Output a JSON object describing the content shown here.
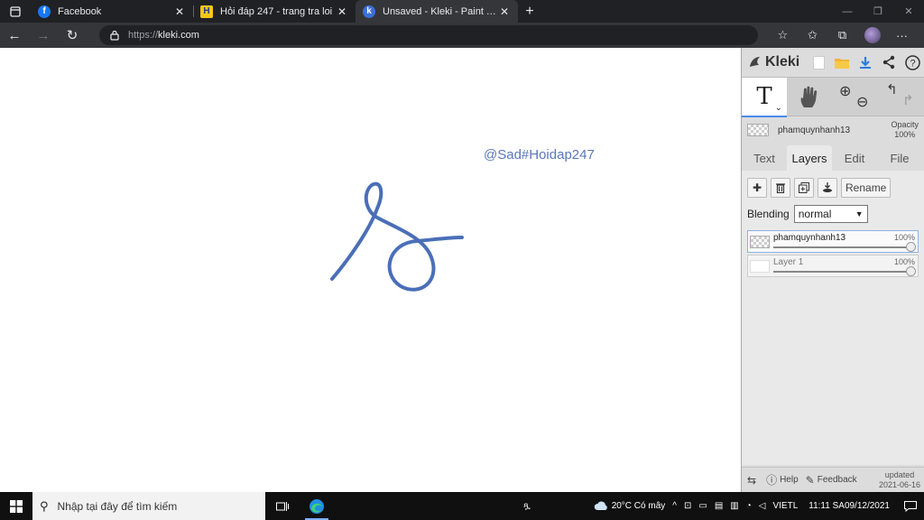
{
  "browser": {
    "tabs": [
      {
        "title": "Facebook",
        "favicon": "facebook-icon",
        "active": false
      },
      {
        "title": "Hỏi đáp 247 - trang tra loi",
        "favicon": "hoidap-icon",
        "active": false
      },
      {
        "title": "Unsaved - Kleki - Paint Tool",
        "favicon": "kleki-icon",
        "active": true
      }
    ],
    "url_prefix": "https://",
    "url_host": "kleki.com"
  },
  "canvas": {
    "watermark": "@Sad#Hoidap247",
    "stroke_color": "#4a6fb8"
  },
  "kleki": {
    "logo": "Kleki",
    "tool_T": "T",
    "current_layer_name": "phamquynhanh13",
    "opacity_label": "Opacity",
    "opacity_value": "100%",
    "tabs": [
      {
        "label": "Text",
        "active": false
      },
      {
        "label": "Layers",
        "active": true
      },
      {
        "label": "Edit",
        "active": false
      },
      {
        "label": "File",
        "active": false
      }
    ],
    "rename_label": "Rename",
    "blending_label": "Blending",
    "blending_value": "normal",
    "layers": [
      {
        "name": "phamquynhanh13",
        "opacity": "100%",
        "selected": true
      },
      {
        "name": "Layer 1",
        "opacity": "100%",
        "selected": false
      }
    ],
    "footer": {
      "help": "Help",
      "feedback": "Feedback",
      "updated_label": "updated",
      "updated_date": "2021-06-16"
    }
  },
  "taskbar": {
    "search_placeholder": "Nhập tại đây để tìm kiếm",
    "weather": "20°C  Có mây",
    "lang_line1": "VIE",
    "lang_line2": "TL",
    "time": "11:11 SA",
    "date": "09/12/2021"
  },
  "colors": {
    "accent": "#4c89ee",
    "chrome_dark": "#202124",
    "chrome_mid": "#35363a"
  }
}
